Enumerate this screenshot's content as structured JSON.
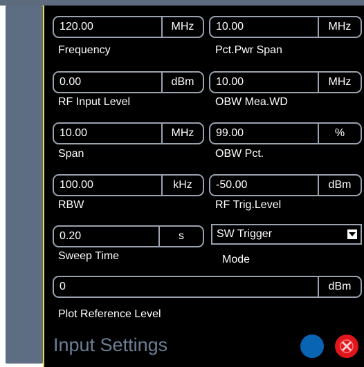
{
  "fields": {
    "frequency": {
      "value": "120.00",
      "unit": "MHz",
      "label": "Frequency"
    },
    "rf_input_level": {
      "value": "0.00",
      "unit": "dBm",
      "label": "RF Input Level"
    },
    "span": {
      "value": "10.00",
      "unit": "MHz",
      "label": "Span"
    },
    "rbw": {
      "value": "100.00",
      "unit": "kHz",
      "label": "RBW"
    },
    "sweep_time": {
      "value": "0.20",
      "unit": "s",
      "label": "Sweep Time"
    },
    "pct_pwr_span": {
      "value": "10.00",
      "unit": "MHz",
      "label": "Pct.Pwr Span"
    },
    "obw_mea_wd": {
      "value": "10.00",
      "unit": "MHz",
      "label": "OBW Mea.WD"
    },
    "obw_pct": {
      "value": "99.00",
      "unit": "%",
      "label": "OBW Pct."
    },
    "rf_trig_level": {
      "value": "-50.00",
      "unit": "dBm",
      "label": "RF Trig.Level"
    },
    "plot_reference_level": {
      "value": "0",
      "unit": "dBm",
      "label": "Plot Reference Level"
    }
  },
  "mode": {
    "selected": "SW Trigger",
    "label": "Mode"
  },
  "footer": {
    "title": "Input Settings"
  },
  "colors": {
    "panel_bg": "#000000",
    "title": "#6b7f96",
    "blue_button": "#0a64b4",
    "close_button": "#e0161c",
    "accent_border": "#e8d94a"
  },
  "icons": {
    "dropdown": "chevron-down-icon",
    "close": "close-icon"
  }
}
